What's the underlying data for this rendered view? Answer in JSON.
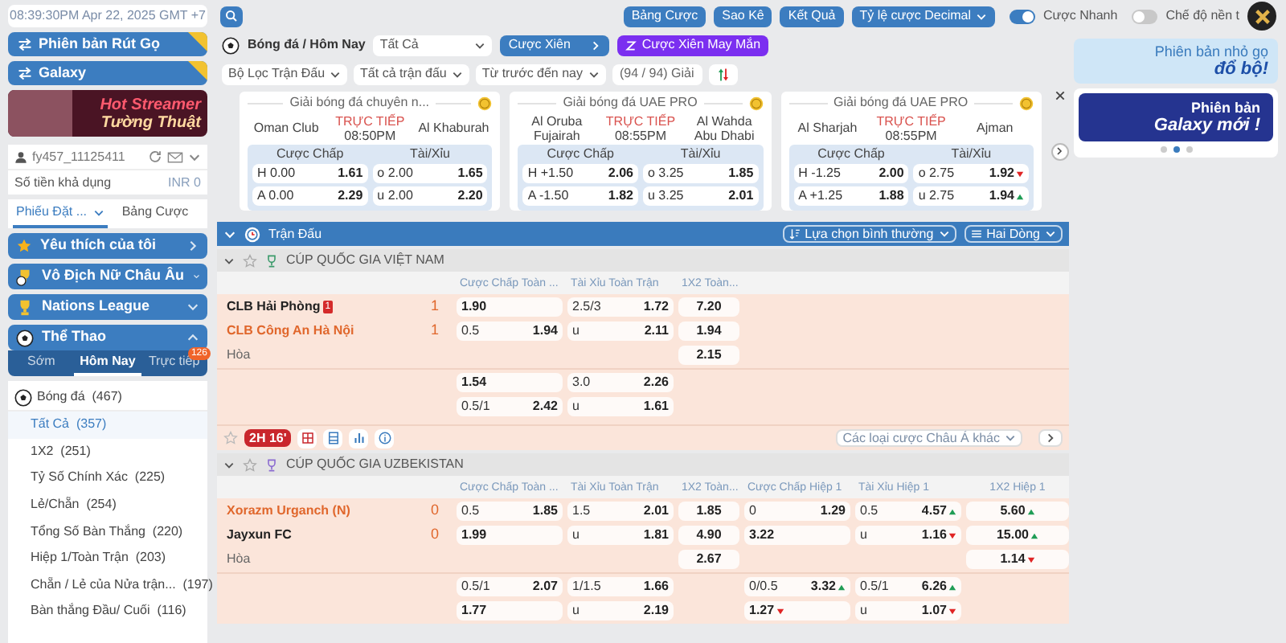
{
  "clock": "08:39:30PM Apr 22, 2025 GMT +7",
  "sidebar": {
    "promos": [
      "Phiên bản Rút Gọ",
      "Galaxy"
    ],
    "banner": {
      "title": "Hot Streamer",
      "subtitle": "Tường Thuật"
    },
    "account": {
      "user": "fy457_11125411",
      "balance_label": "Số tiền khả dụng",
      "balance": "INR 0"
    },
    "tabs": [
      {
        "label": "Phiếu Đặt ...",
        "selected": true
      },
      {
        "label": "Bảng Cược",
        "selected": false
      }
    ],
    "sections": [
      {
        "label": "Yêu thích của tôi",
        "kind": "favorites",
        "expanded": false
      },
      {
        "label": "Vô Địch Nữ Châu Âu",
        "kind": "league",
        "expanded": false
      },
      {
        "label": "Nations League",
        "kind": "cup",
        "expanded": false
      },
      {
        "label": "Thể Thao",
        "kind": "sports",
        "expanded": true
      }
    ],
    "sport_tabs": [
      {
        "label": "Sớm",
        "selected": false
      },
      {
        "label": "Hôm Nay",
        "selected": true
      },
      {
        "label": "Trực tiếp",
        "selected": false,
        "badge": "126"
      }
    ],
    "sport": "Bóng đá  (467)",
    "bet_types": [
      {
        "label": "Tất Cả  (357)",
        "selected": true
      },
      {
        "label": "1X2  (251)",
        "selected": false
      },
      {
        "label": "Tỷ Số Chính Xác  (225)",
        "selected": false
      },
      {
        "label": "Lẻ/Chẵn  (254)",
        "selected": false
      },
      {
        "label": "Tổng Số Bàn Thắng  (220)",
        "selected": false
      },
      {
        "label": "Hiệp 1/Toàn Trận  (203)",
        "selected": false
      },
      {
        "label": "Chẵn / Lẻ của Nửa trận...  (197)",
        "selected": false
      },
      {
        "label": "Bàn thắng Đầu/ Cuối  (116)",
        "selected": false
      }
    ]
  },
  "top_bar": {
    "buttons": [
      "Bảng Cược",
      "Sao Kê",
      "Kết Quả"
    ],
    "odds_format": "Tỷ lệ cược Decimal",
    "toggles": [
      {
        "label": "Cược Nhanh",
        "on": true
      },
      {
        "label": "Chế độ nền t",
        "on": false
      }
    ]
  },
  "filter_bar": {
    "breadcrumb": "Bóng đá / Hôm Nay",
    "market_select": "Tất Cả",
    "parlay": "Cược Xiên",
    "lucky_parlay": "Cược Xiên May Mắn",
    "filters": [
      "Bộ Lọc Trận Đấu",
      "Tất cả trận đấu",
      "Từ trước đến nay"
    ],
    "league_count": "(94 / 94) Giải"
  },
  "live_cards": [
    {
      "league": "Giải bóng đá chuyên n...",
      "home": "Oman Club",
      "away": "Al Khaburah",
      "status": "TRỰC TIẾP",
      "time": "08:50PM",
      "headers": [
        "Cược Chấp",
        "Tài/Xỉu"
      ],
      "rows": [
        [
          {
            "side": "H",
            "line": "0.00",
            "odds": "1.61"
          },
          {
            "side": "o",
            "line": "2.00",
            "odds": "1.65"
          }
        ],
        [
          {
            "side": "A",
            "line": "0.00",
            "odds": "2.29"
          },
          {
            "side": "u",
            "line": "2.00",
            "odds": "2.20"
          }
        ]
      ]
    },
    {
      "league": "Giải bóng đá UAE PRO",
      "home": "Al Oruba Fujairah",
      "away": "Al Wahda Abu Dhabi",
      "status": "TRỰC TIẾP",
      "time": "08:55PM",
      "headers": [
        "Cược Chấp",
        "Tài/Xỉu"
      ],
      "rows": [
        [
          {
            "side": "H",
            "line": "+1.50",
            "odds": "2.06"
          },
          {
            "side": "o",
            "line": "3.25",
            "odds": "1.85"
          }
        ],
        [
          {
            "side": "A",
            "line": "-1.50",
            "odds": "1.82"
          },
          {
            "side": "u",
            "line": "3.25",
            "odds": "2.01"
          }
        ]
      ]
    },
    {
      "league": "Giải bóng đá UAE PRO",
      "home": "Al Sharjah",
      "away": "Ajman",
      "status": "TRỰC TIẾP",
      "time": "08:55PM",
      "headers": [
        "Cược Chấp",
        "Tài/Xỉu"
      ],
      "rows": [
        [
          {
            "side": "H",
            "line": "-1.25",
            "odds": "2.00"
          },
          {
            "side": "o",
            "line": "2.75",
            "odds": "1.92",
            "trend_up": false
          }
        ],
        [
          {
            "side": "A",
            "line": "+1.25",
            "odds": "1.88"
          },
          {
            "side": "u",
            "line": "2.75",
            "odds": "1.94",
            "trend_up": true
          }
        ]
      ]
    }
  ],
  "matches": {
    "title": "Trận Đấu",
    "sort": "Lựa chọn bình thường",
    "view": "Hai Dòng",
    "leagues": [
      {
        "name": "CÚP QUỐC GIA VIỆT NAM",
        "columns": [
          "Cược Chấp Toàn ...",
          "Tài Xỉu Toàn Trận",
          "1X2 Toàn..."
        ],
        "teams": [
          {
            "name": "CLB Hải Phòng",
            "score": "1",
            "favorite": false,
            "red_cards": "1"
          },
          {
            "name": "CLB Công An Hà Nội",
            "score": "1",
            "favorite": true
          }
        ],
        "draw": "Hòa",
        "blocks": [
          [
            [
              {
                "kind": "odds",
                "odds": "1.90"
              },
              {
                "kind": "odds",
                "line": "2.5/3",
                "odds": "1.72"
              },
              {
                "kind": "odds",
                "odds": "7.20"
              }
            ],
            [
              {
                "kind": "odds",
                "line": "0.5",
                "odds": "1.94"
              },
              {
                "kind": "odds",
                "line": "u",
                "odds": "2.11"
              },
              {
                "kind": "odds",
                "odds": "1.94"
              }
            ],
            [
              {
                "kind": "blank"
              },
              {
                "kind": "blank"
              },
              {
                "kind": "odds",
                "odds": "2.15"
              }
            ]
          ],
          [
            [
              {
                "kind": "odds",
                "odds": "1.54"
              },
              {
                "kind": "odds",
                "line": "3.0",
                "odds": "2.26"
              }
            ],
            [
              {
                "kind": "odds",
                "line": "0.5/1",
                "odds": "2.42"
              },
              {
                "kind": "odds",
                "line": "u",
                "odds": "1.61"
              }
            ]
          ]
        ],
        "live_time": "2H 16'",
        "more_markets": "Các loại cược Châu Á khác"
      },
      {
        "name": "CÚP QUỐC GIA UZBEKISTAN",
        "columns": [
          "Cược Chấp Toàn ...",
          "Tài Xỉu Toàn Trận",
          "1X2 Toàn...",
          "Cược Chấp Hiệp 1",
          "Tài Xỉu Hiệp 1",
          "1X2 Hiệp 1"
        ],
        "teams": [
          {
            "name": "Xorazm Urganch (N)",
            "score": "0",
            "favorite": true
          },
          {
            "name": "Jayxun FC",
            "score": "0",
            "favorite": false
          }
        ],
        "draw": "Hòa",
        "blocks": [
          [
            [
              {
                "kind": "odds",
                "line": "0.5",
                "odds": "1.85"
              },
              {
                "kind": "odds",
                "line": "1.5",
                "odds": "2.01"
              },
              {
                "kind": "odds",
                "odds": "1.85"
              },
              {
                "kind": "odds",
                "line": "0",
                "odds": "1.29"
              },
              {
                "kind": "odds",
                "line": "0.5",
                "odds": "4.57",
                "trend_up": true
              },
              {
                "kind": "odds",
                "odds": "5.60",
                "trend_up": true
              }
            ],
            [
              {
                "kind": "odds",
                "odds": "1.99"
              },
              {
                "kind": "odds",
                "line": "u",
                "odds": "1.81"
              },
              {
                "kind": "odds",
                "odds": "4.90"
              },
              {
                "kind": "odds",
                "odds": "3.22"
              },
              {
                "kind": "odds",
                "line": "u",
                "odds": "1.16",
                "trend_up": false
              },
              {
                "kind": "odds",
                "odds": "15.00",
                "trend_up": true
              }
            ],
            [
              {
                "kind": "blank"
              },
              {
                "kind": "blank"
              },
              {
                "kind": "odds",
                "odds": "2.67"
              },
              {
                "kind": "blank"
              },
              {
                "kind": "blank"
              },
              {
                "kind": "odds",
                "odds": "1.14",
                "trend_up": false
              }
            ]
          ],
          [
            [
              {
                "kind": "odds",
                "line": "0.5/1",
                "odds": "2.07"
              },
              {
                "kind": "odds",
                "line": "1/1.5",
                "odds": "1.66"
              },
              {
                "kind": "blank"
              },
              {
                "kind": "odds",
                "line": "0/0.5",
                "odds": "3.32",
                "trend_up": true
              },
              {
                "kind": "odds",
                "line": "0.5/1",
                "odds": "6.26",
                "trend_up": true
              }
            ],
            [
              {
                "kind": "odds",
                "odds": "1.77"
              },
              {
                "kind": "odds",
                "line": "u",
                "odds": "2.19"
              },
              {
                "kind": "blank"
              },
              {
                "kind": "odds",
                "odds": "1.27",
                "trend_up": false
              },
              {
                "kind": "odds",
                "line": "u",
                "odds": "1.07",
                "trend_up": false
              }
            ]
          ]
        ]
      }
    ]
  },
  "ads": [
    {
      "title": "Phiên bản nhỏ gọ",
      "subtitle": "đổ bộ!"
    },
    {
      "title": "Phiên bản",
      "subtitle": "Galaxy mới !"
    }
  ],
  "ad_dots": [
    {
      "selected": false
    },
    {
      "selected": true
    },
    {
      "selected": false
    }
  ]
}
